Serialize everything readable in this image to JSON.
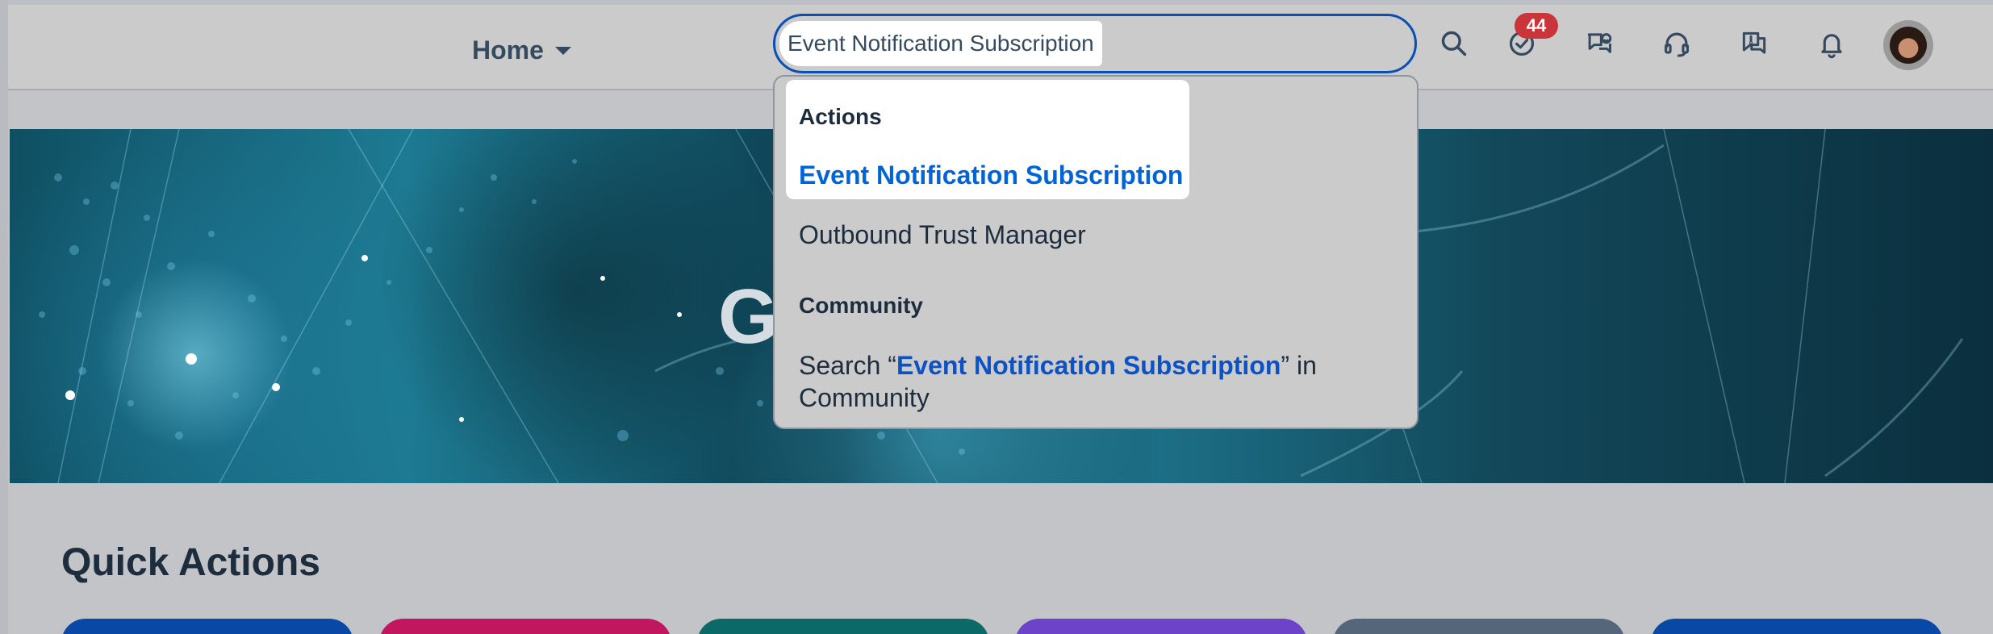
{
  "shell": {
    "home_label": "Home",
    "search_value": "Event Notification Subscription",
    "notification_badge": "44",
    "icons": [
      "search-icon",
      "task-check-icon",
      "chat-assistant-icon",
      "support-headset-icon",
      "feedback-icon",
      "bell-icon"
    ]
  },
  "hero": {
    "title_visible": "G"
  },
  "suggestions": {
    "groups": [
      {
        "title": "Actions",
        "items": [
          "Event Notification Subscription",
          "Outbound Trust Manager"
        ]
      },
      {
        "title": "Community"
      }
    ],
    "community_search": {
      "prefix": "Search “",
      "term": "Event Notification Subscription",
      "suffix": "” in Community"
    }
  },
  "quick_actions": {
    "title": "Quick Actions",
    "tile_colors": [
      "#0a48a6",
      "#c0175f",
      "#0b6a68",
      "#6c43c9",
      "#55667a",
      "#0a48a6"
    ]
  },
  "colors": {
    "accent": "#0064d9",
    "search_border": "#0a4fb5",
    "badge": "#c9353b"
  }
}
